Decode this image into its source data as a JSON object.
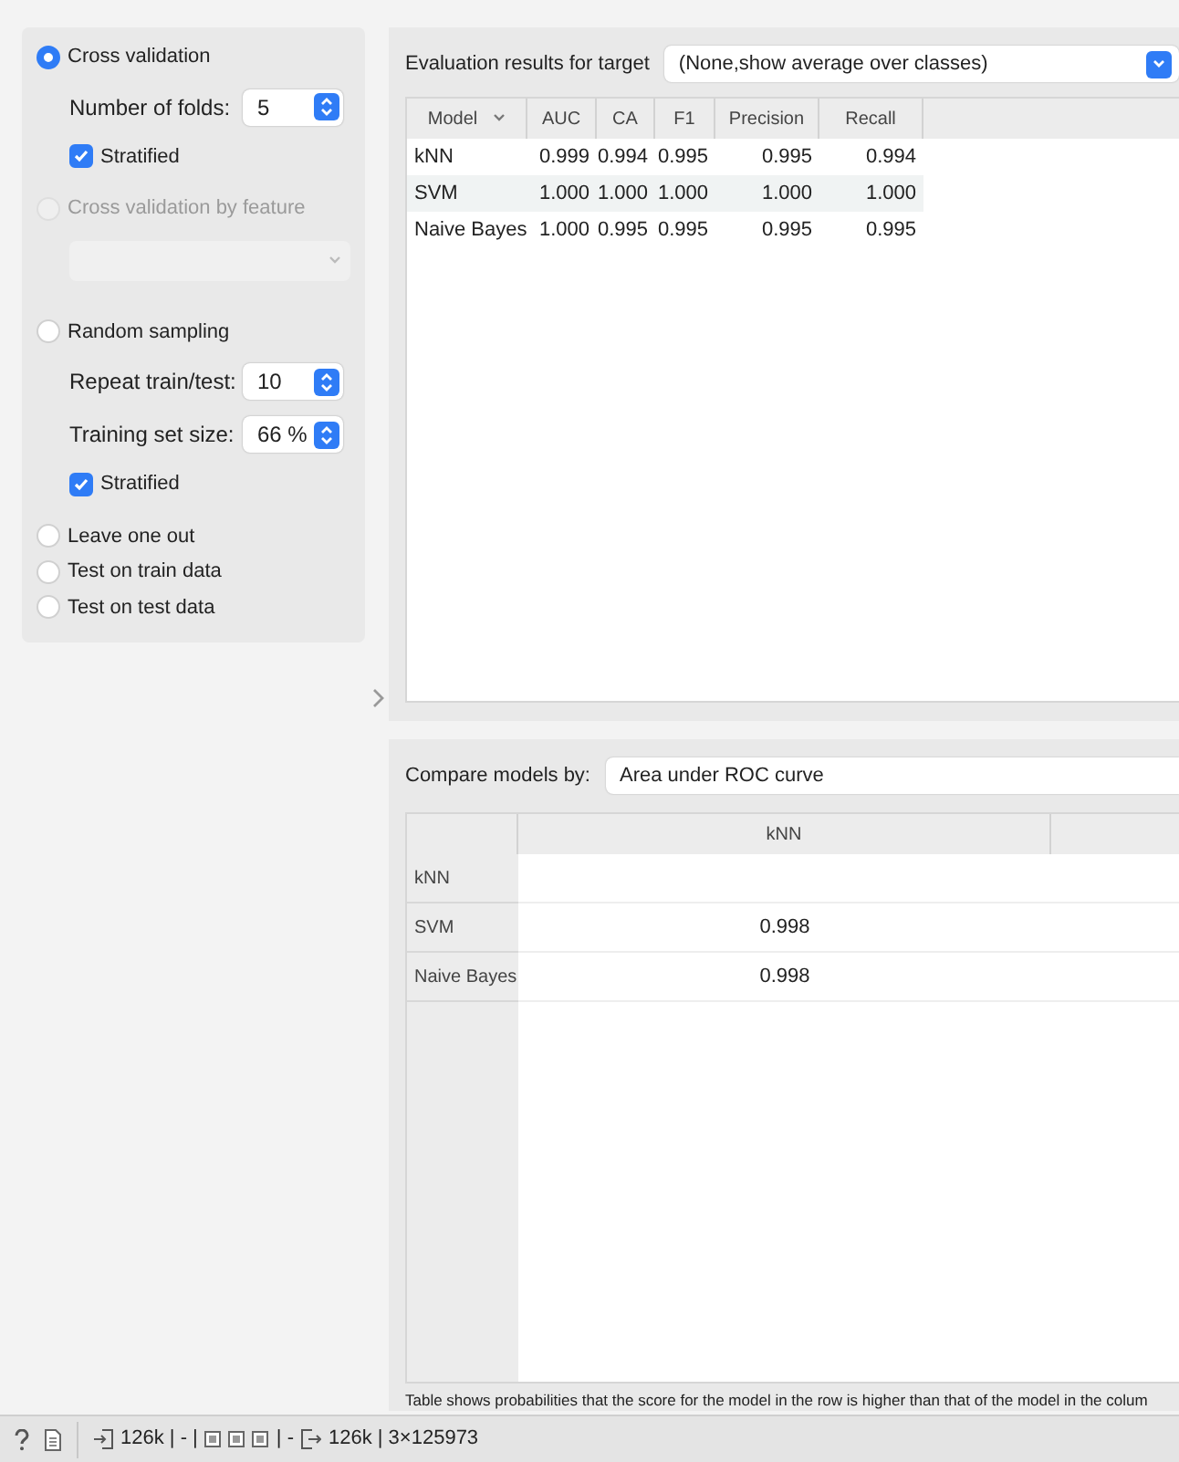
{
  "sampling": [
    {
      "kind": "radio",
      "label": "Cross validation",
      "selected": true,
      "disabled": false,
      "children": [
        {
          "kind": "spin",
          "label": "Number of folds:",
          "value": "5"
        },
        {
          "kind": "checkbox",
          "label": "Stratified",
          "checked": true
        }
      ]
    },
    {
      "kind": "radio",
      "label": "Cross validation by feature",
      "selected": false,
      "disabled": true,
      "children": [
        {
          "kind": "combo",
          "disabled": true
        }
      ]
    },
    {
      "kind": "radio",
      "label": "Random sampling",
      "selected": false,
      "disabled": false,
      "children": [
        {
          "kind": "spin",
          "label": "Repeat train/test:",
          "value": "10"
        },
        {
          "kind": "spin",
          "label": "Training set size:",
          "value": "66 %"
        },
        {
          "kind": "checkbox",
          "label": "Stratified",
          "checked": true
        }
      ]
    },
    {
      "kind": "radio",
      "label": "Leave one out",
      "selected": false,
      "disabled": false
    },
    {
      "kind": "radio",
      "label": "Test on train data",
      "selected": false,
      "disabled": false
    },
    {
      "kind": "radio",
      "label": "Test on test data",
      "selected": false,
      "disabled": false
    }
  ],
  "results": {
    "target_label": "Evaluation results for target",
    "target_value": "(None,show average over classes)",
    "columns": [
      "Model",
      "AUC",
      "CA",
      "F1",
      "Precision",
      "Recall"
    ],
    "rows": [
      {
        "model": "kNN",
        "values": [
          "0.999",
          "0.994",
          "0.995",
          "0.995",
          "0.994"
        ]
      },
      {
        "model": "SVM",
        "values": [
          "1.000",
          "1.000",
          "1.000",
          "1.000",
          "1.000"
        ]
      },
      {
        "model": "Naive Bayes",
        "values": [
          "1.000",
          "0.995",
          "0.995",
          "0.995",
          "0.995"
        ]
      }
    ]
  },
  "compare": {
    "label": "Compare models by:",
    "value": "Area under ROC curve",
    "columns": [
      "kNN"
    ],
    "rows": [
      {
        "label": "kNN"
      },
      {
        "label": "SVM",
        "value": "0.998"
      },
      {
        "label": "Naive Bayes",
        "value": "0.998"
      }
    ],
    "note": "Table shows probabilities that the score for the model in the row is higher than that of the model in the colum"
  },
  "status_bar": {
    "input": "126k | - |",
    "input_tail": "| -",
    "output": "126k | 3×125973"
  }
}
